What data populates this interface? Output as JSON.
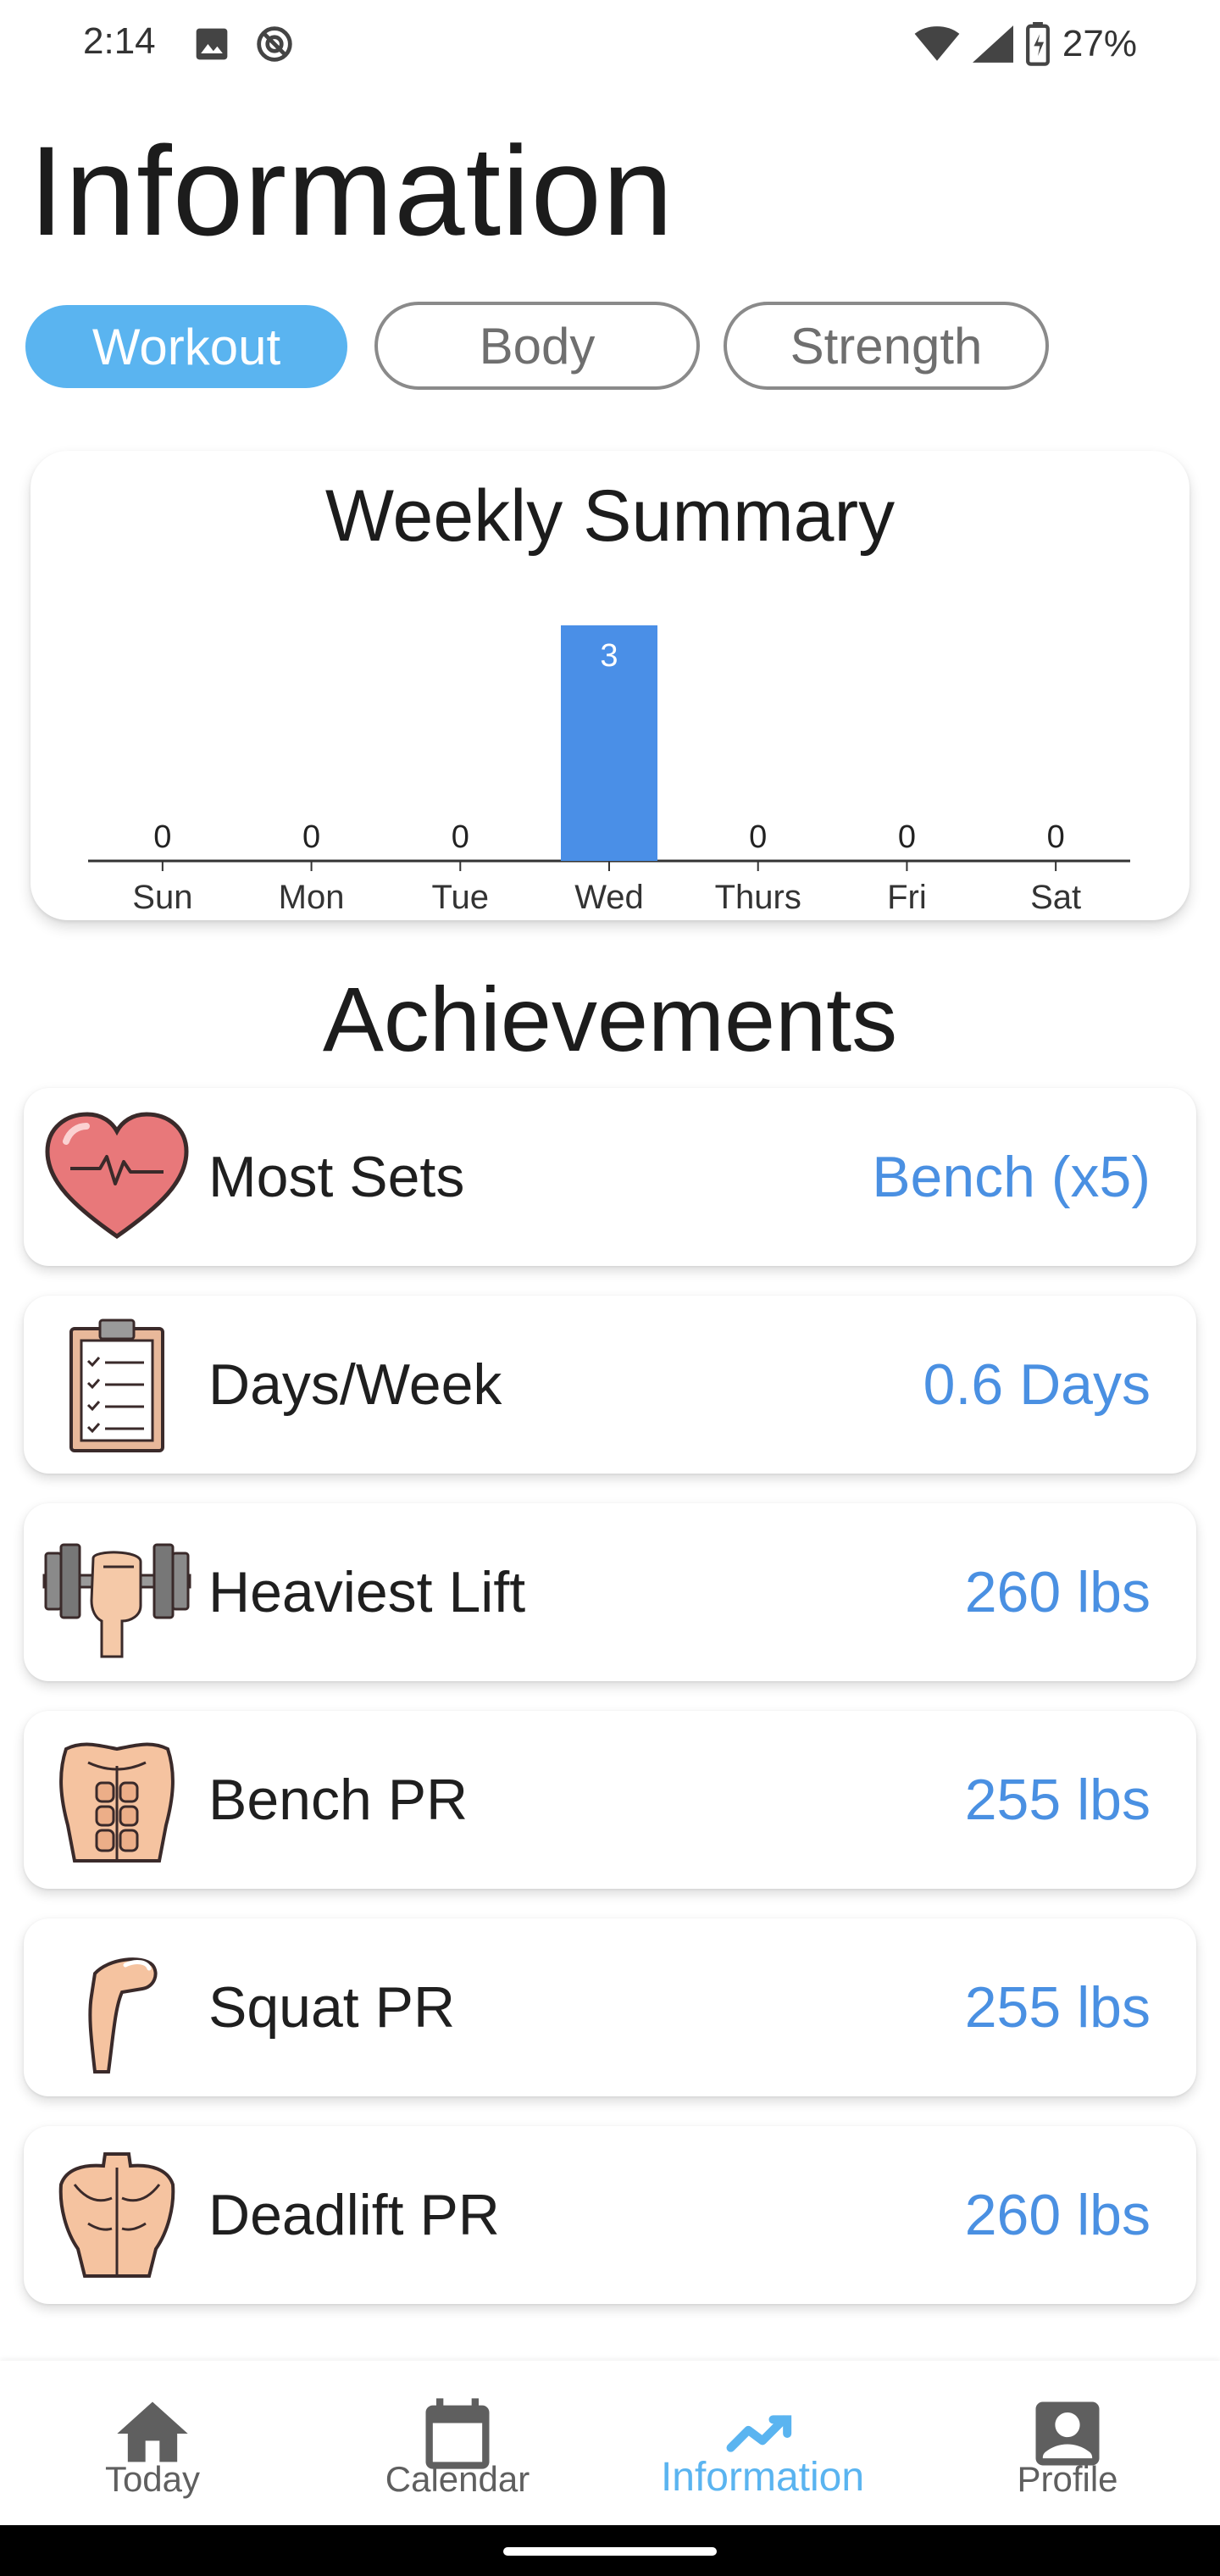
{
  "status_bar": {
    "time": "2:14",
    "battery": "27%",
    "icons": [
      "image-icon",
      "do-not-disturb-icon",
      "wifi-icon",
      "cell-signal-icon",
      "battery-icon"
    ]
  },
  "page": {
    "title": "Information"
  },
  "tabs": [
    {
      "label": "Workout",
      "active": true
    },
    {
      "label": "Body",
      "active": false
    },
    {
      "label": "Strength",
      "active": false
    }
  ],
  "colors": {
    "accent": "#5ab4f0",
    "bar": "#4a8fe7",
    "value_text": "#4a90e2"
  },
  "summary": {
    "title": "Weekly Summary"
  },
  "chart_data": {
    "type": "bar",
    "title": "Weekly Summary",
    "categories": [
      "Sun",
      "Mon",
      "Tue",
      "Wed",
      "Thurs",
      "Fri",
      "Sat"
    ],
    "values": [
      0,
      0,
      0,
      3,
      0,
      0,
      0
    ],
    "value_labels": [
      "0",
      "0",
      "0",
      "3",
      "0",
      "0",
      "0"
    ],
    "xlabel": "",
    "ylabel": "",
    "ylim": [
      0,
      3
    ],
    "grid": false,
    "legend": "none"
  },
  "achievements": {
    "title": "Achievements",
    "items": [
      {
        "label": "Most Sets",
        "value": "Bench (x5)",
        "icon": "heart-icon"
      },
      {
        "label": "Days/Week",
        "value": "0.6 Days",
        "icon": "clipboard-icon"
      },
      {
        "label": "Heaviest Lift",
        "value": "260 lbs",
        "icon": "dumbbell-icon"
      },
      {
        "label": "Bench PR",
        "value": "255 lbs",
        "icon": "abs-icon"
      },
      {
        "label": "Squat PR",
        "value": "255 lbs",
        "icon": "leg-icon"
      },
      {
        "label": "Deadlift PR",
        "value": "260 lbs",
        "icon": "back-muscle-icon"
      }
    ]
  },
  "bottom_nav": [
    {
      "label": "Today",
      "icon": "home-icon",
      "active": false
    },
    {
      "label": "Calendar",
      "icon": "calendar-icon",
      "active": false
    },
    {
      "label": "Information",
      "icon": "trending-icon",
      "active": true
    },
    {
      "label": "Profile",
      "icon": "profile-icon",
      "active": false
    }
  ]
}
